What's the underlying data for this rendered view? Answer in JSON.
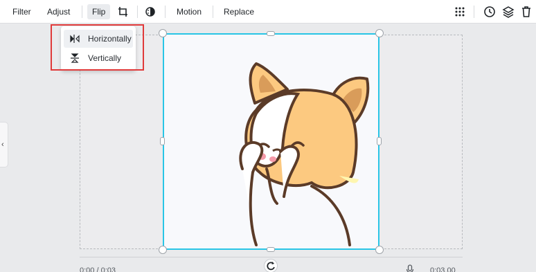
{
  "toolbar": {
    "filter_label": "Filter",
    "adjust_label": "Adjust",
    "flip_label": "Flip",
    "motion_label": "Motion",
    "replace_label": "Replace",
    "icons": [
      "crop-icon",
      "transparency-icon",
      "grid-icon",
      "history-icon",
      "layers-icon",
      "trash-icon"
    ]
  },
  "flip_menu": {
    "items": [
      {
        "label": "Horizontally",
        "icon": "flip-horizontal-icon"
      },
      {
        "label": "Vertically",
        "icon": "flip-vertical-icon"
      }
    ]
  },
  "timeline": {
    "current_time": "0:00 / 0:03",
    "end_time": "0:03.00"
  },
  "colors": {
    "selection": "#29c5e6",
    "highlight": "#e03a3a",
    "corgi_fur": "#fcc980",
    "outline": "#5b3b28"
  }
}
